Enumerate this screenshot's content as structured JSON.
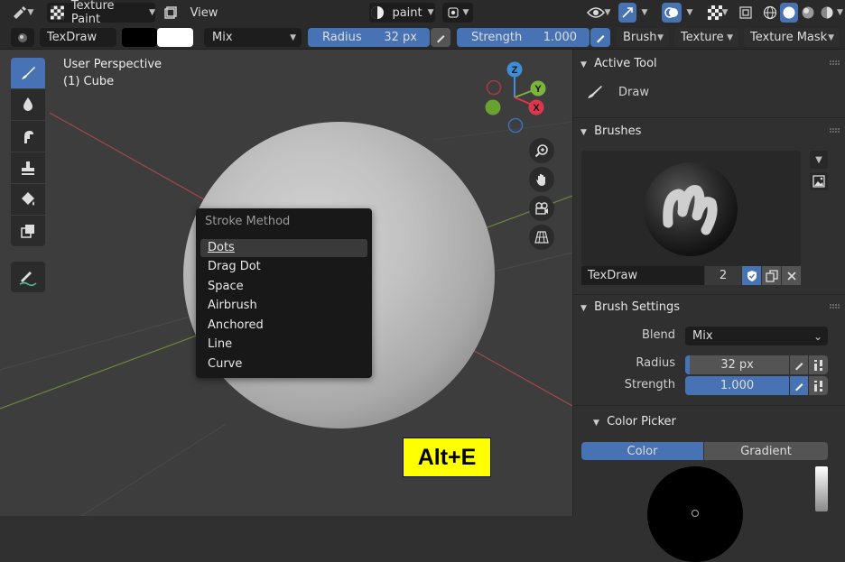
{
  "header": {
    "mode_label": "Texture Paint",
    "view_label": "View",
    "paint_label": "paint"
  },
  "tool_header": {
    "brush_name": "TexDraw",
    "blend": "Mix",
    "radius_label": "Radius",
    "radius_value": "32 px",
    "strength_label": "Strength",
    "strength_value": "1.000",
    "brush_menu": "Brush",
    "texture_menu": "Texture",
    "texture_mask_menu": "Texture Mask"
  },
  "viewport": {
    "perspective": "User Perspective",
    "object": "(1) Cube",
    "gizmo": {
      "z": "Z",
      "y": "Y",
      "x": "X"
    }
  },
  "stroke_popup": {
    "title": "Stroke Method",
    "items": [
      "Dots",
      "Drag Dot",
      "Space",
      "Airbrush",
      "Anchored",
      "Line",
      "Curve"
    ],
    "selected": "Dots"
  },
  "shortcut": "Alt+E",
  "panel": {
    "active_tool": {
      "title": "Active Tool",
      "tool": "Draw"
    },
    "brushes": {
      "title": "Brushes",
      "name": "TexDraw",
      "users": "2"
    },
    "brush_settings": {
      "title": "Brush Settings",
      "blend_label": "Blend",
      "blend_value": "Mix",
      "radius_label": "Radius",
      "radius_value": "32 px",
      "strength_label": "Strength",
      "strength_value": "1.000"
    },
    "color_picker": {
      "title": "Color Picker",
      "tab_color": "Color",
      "tab_gradient": "Gradient"
    }
  },
  "colors": {
    "accent": "#4772b3",
    "popup_bg": "#181818",
    "shortcut_bg": "#ffff00",
    "active_tool": "#4772b3"
  }
}
